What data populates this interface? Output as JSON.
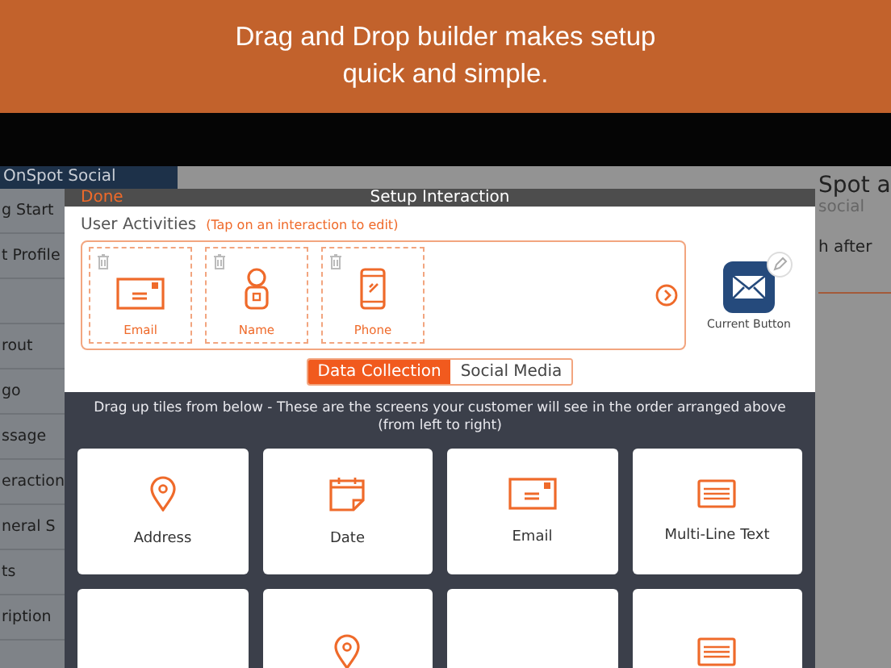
{
  "banner": {
    "text": "Drag and Drop builder makes setup quick and simple."
  },
  "sidebar": {
    "title": "OnSpot Social",
    "items": [
      {
        "kind": "link",
        "label": "g Start"
      },
      {
        "kind": "link",
        "label": "t Profile"
      },
      {
        "kind": "blank"
      },
      {
        "kind": "link",
        "label": "rout"
      },
      {
        "kind": "link",
        "label": "go"
      },
      {
        "kind": "link",
        "label": "ssage"
      },
      {
        "kind": "link",
        "label": "eraction"
      },
      {
        "kind": "link",
        "label": "neral S"
      },
      {
        "kind": "link",
        "label": "ts"
      },
      {
        "kind": "link",
        "label": "ription"
      }
    ]
  },
  "background_page": {
    "logo_text": "Spot a",
    "logo_subtext": "social",
    "line": "h after"
  },
  "dialog": {
    "title": "Setup Interaction",
    "done": "Done",
    "activities_label": "User Activities",
    "activities_hint": "(Tap on an interaction to edit)",
    "activities": [
      {
        "kind": "email",
        "label": "Email"
      },
      {
        "kind": "name",
        "label": "Name"
      },
      {
        "kind": "phone",
        "label": "Phone"
      }
    ],
    "current_button": {
      "label": "Current Button"
    },
    "segments": [
      {
        "label": "Data Collection",
        "selected": true
      },
      {
        "label": "Social Media",
        "selected": false
      }
    ],
    "instructions": "Drag up tiles from below - These are the screens your customer will see in the order arranged above (from left to right)",
    "tiles": [
      {
        "kind": "address",
        "label": "Address"
      },
      {
        "kind": "date",
        "label": "Date"
      },
      {
        "kind": "email",
        "label": "Email"
      },
      {
        "kind": "multiline",
        "label": "Multi-Line Text"
      },
      {
        "kind": "blank"
      },
      {
        "kind": "address"
      },
      {
        "kind": "blank"
      },
      {
        "kind": "multiline"
      }
    ]
  }
}
